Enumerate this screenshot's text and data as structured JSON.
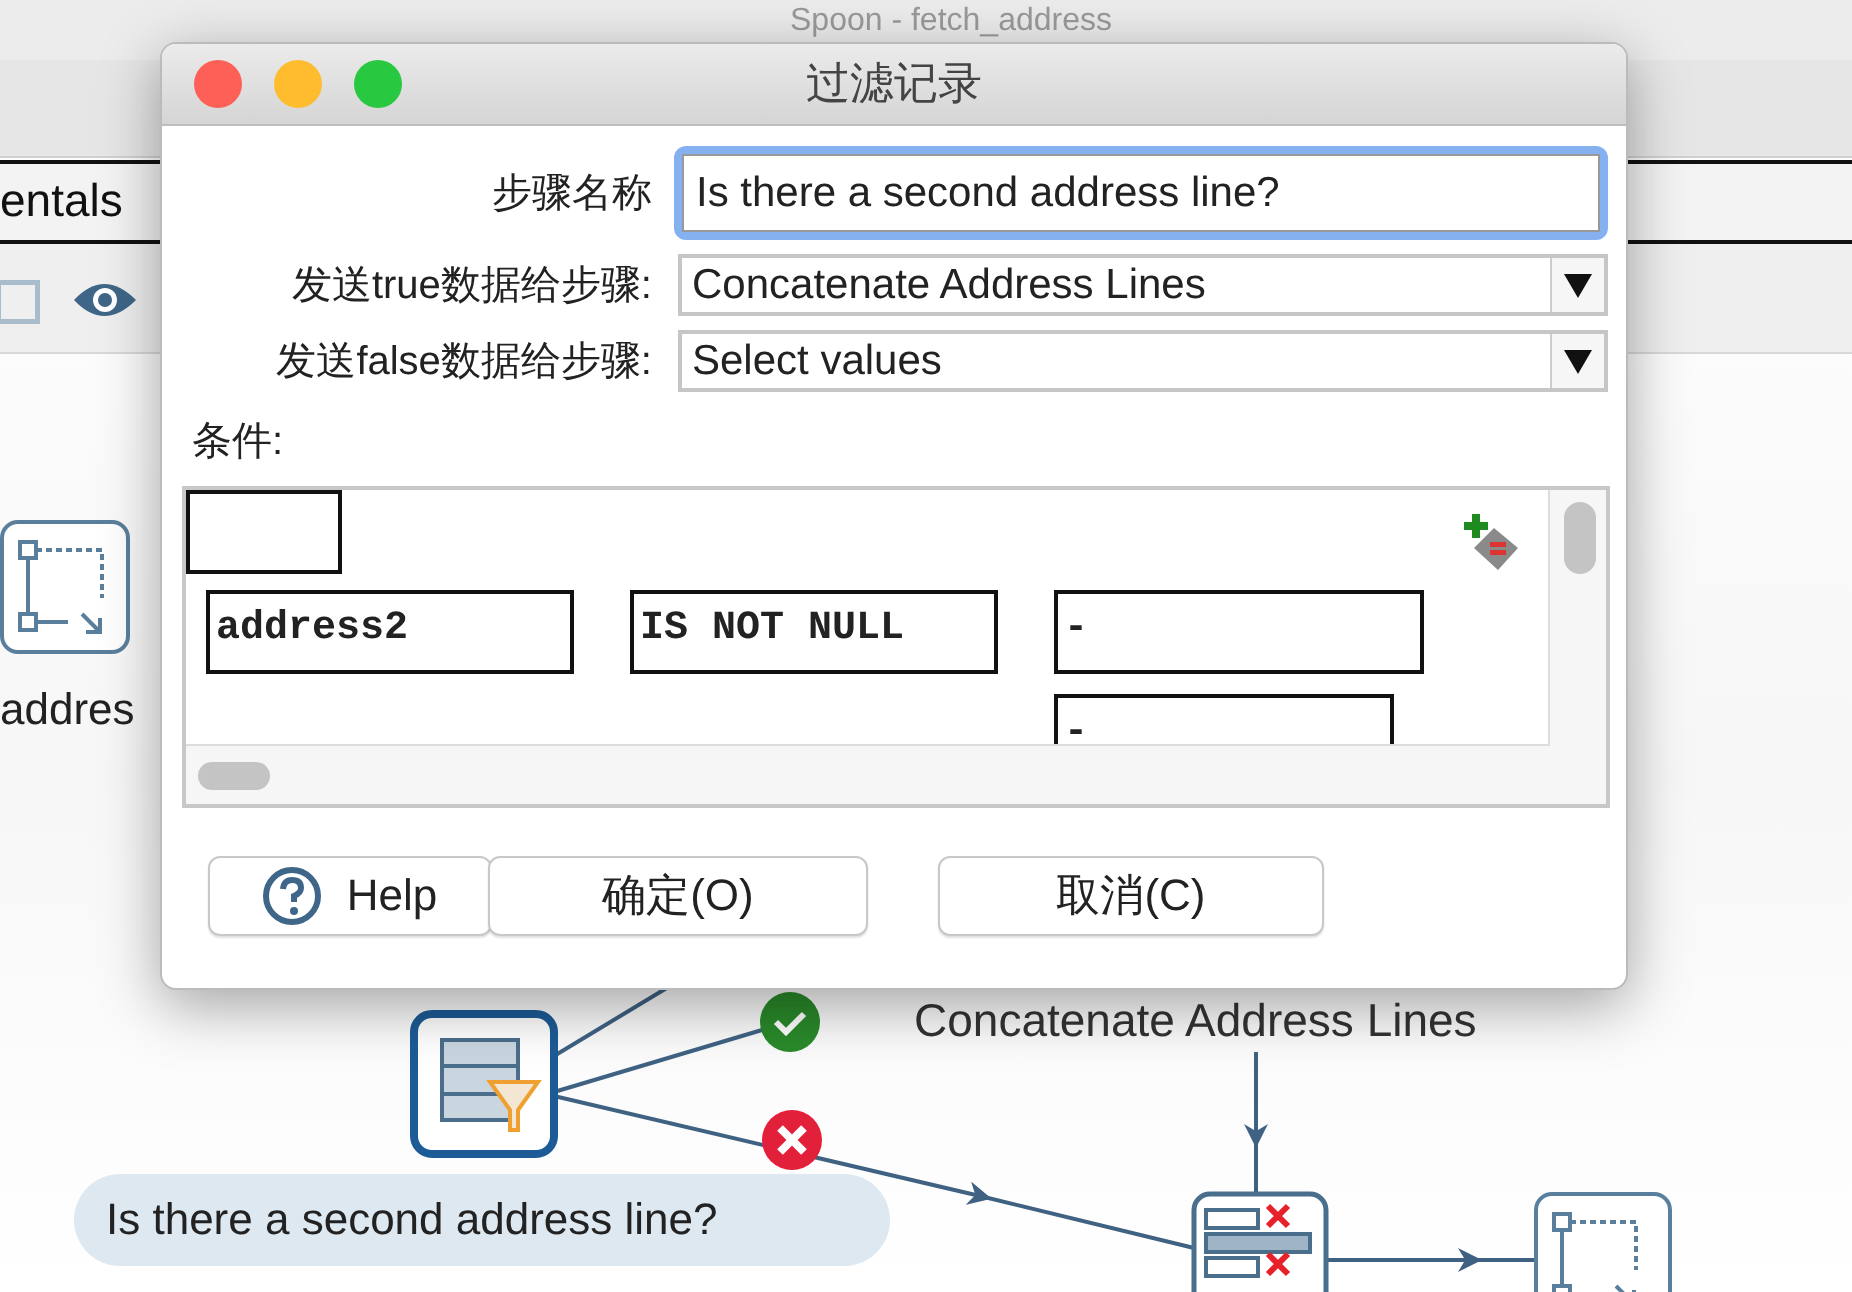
{
  "app_window": {
    "title": "Spoon - fetch_address",
    "tab": {
      "label": "entals"
    }
  },
  "canvas": {
    "steps": [
      {
        "kind": "select",
        "label": "addres"
      },
      {
        "kind": "filter",
        "label": "Is there a second address line?"
      },
      {
        "kind": "label",
        "label": "Concatenate Address Lines"
      },
      {
        "kind": "validator"
      },
      {
        "kind": "select"
      }
    ]
  },
  "dialog": {
    "title": "过滤记录",
    "fields": [
      {
        "label": "步骤名称",
        "kind": "text",
        "value": "Is there a second address line?",
        "focused": true
      },
      {
        "label": "发送true数据给步骤:",
        "kind": "dropdown",
        "value": "Concatenate Address Lines",
        "focused": false
      },
      {
        "label": "发送false数据给步骤:",
        "kind": "dropdown",
        "value": "Select values",
        "focused": false
      }
    ],
    "condition": {
      "label": "条件:",
      "field": "address2",
      "function": "IS NOT NULL",
      "value": "-",
      "value_2": "-"
    },
    "buttons": [
      {
        "label": "Help",
        "kind": "help"
      },
      {
        "label": "确定(O)",
        "kind": "plain"
      },
      {
        "label": "取消(C)",
        "kind": "plain"
      }
    ]
  }
}
